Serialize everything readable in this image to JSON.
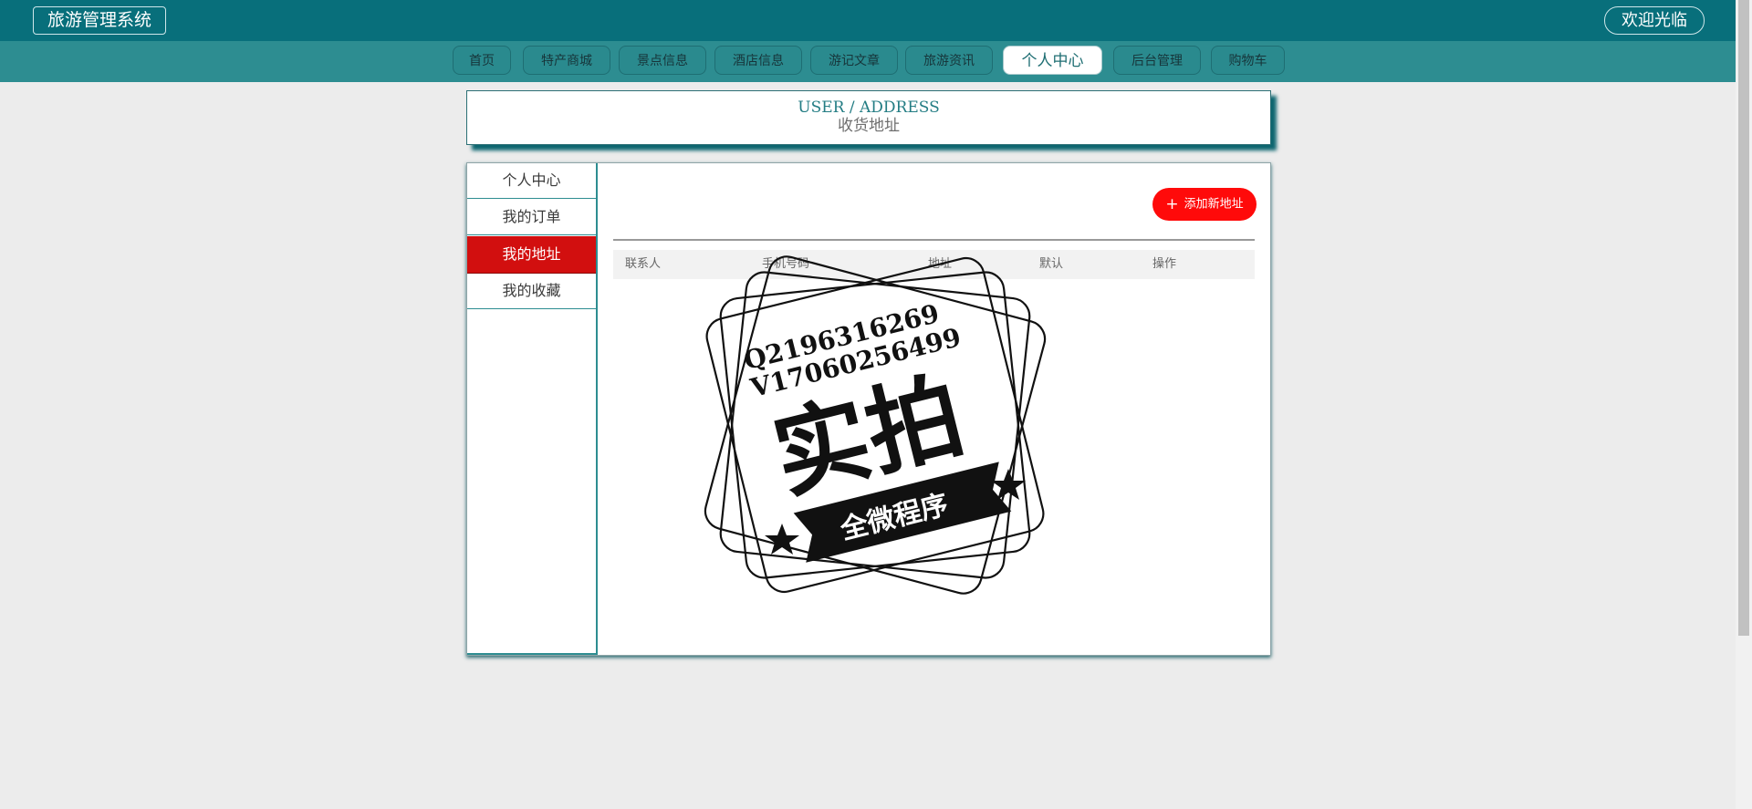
{
  "header": {
    "brand": "旅游管理系统",
    "welcome": "欢迎光临"
  },
  "nav": {
    "items": [
      {
        "label": "首页",
        "active": false
      },
      {
        "label": "特产商城",
        "active": false
      },
      {
        "label": "景点信息",
        "active": false
      },
      {
        "label": "酒店信息",
        "active": false
      },
      {
        "label": "游记文章",
        "active": false
      },
      {
        "label": "旅游资讯",
        "active": false
      },
      {
        "label": "个人中心",
        "active": true
      },
      {
        "label": "后台管理",
        "active": false
      },
      {
        "label": "购物车",
        "active": false
      }
    ]
  },
  "title": {
    "en": "USER / ADDRESS",
    "zh": "收货地址"
  },
  "sidebar": {
    "items": [
      {
        "label": "个人中心",
        "active": false
      },
      {
        "label": "我的订单",
        "active": false
      },
      {
        "label": "我的地址",
        "active": true
      },
      {
        "label": "我的收藏",
        "active": false
      }
    ]
  },
  "content": {
    "add_button": "添加新地址",
    "add_icon": "plus-icon",
    "table_headers": [
      "联系人",
      "手机号码",
      "地址",
      "默认",
      "操作"
    ]
  },
  "watermark": {
    "line1": "Q2196316269",
    "line2": "V17060256499",
    "big": "实拍",
    "ribbon": "全微程序"
  },
  "colors": {
    "header": "#086f7b",
    "nav": "#2d8d91",
    "accent_red": "#ff0a0a",
    "active_side": "#d20f0f"
  }
}
